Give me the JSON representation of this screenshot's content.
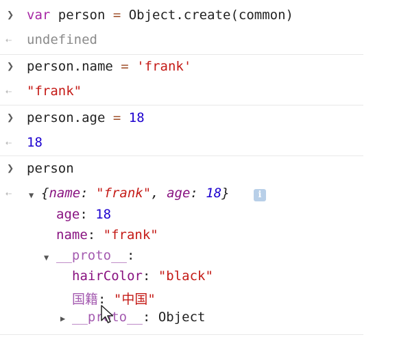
{
  "console": {
    "entries": [
      {
        "input": {
          "tokens": [
            "var",
            " person ",
            "=",
            " Object.create(common)"
          ]
        },
        "output": "undefined"
      },
      {
        "input": {
          "tokens": [
            "person.name ",
            "=",
            " ",
            "'frank'"
          ]
        },
        "output": "\"frank\""
      },
      {
        "input": {
          "tokens": [
            "person.age ",
            "=",
            " ",
            "18"
          ]
        },
        "output": "18"
      },
      {
        "input": {
          "tokens": [
            "person"
          ]
        },
        "object": {
          "summary_open": "{",
          "summary_name_key": "name",
          "summary_colon": ": ",
          "summary_name_val": "\"frank\"",
          "summary_comma": ", ",
          "summary_age_key": "age",
          "summary_age_val": "18",
          "summary_close": "}",
          "info_badge": "i",
          "props": [
            {
              "key": "age",
              "sep": ": ",
              "value": "18"
            },
            {
              "key": "name",
              "sep": ": ",
              "value": "\"frank\""
            }
          ],
          "proto_label": "__proto__",
          "proto_sep": ":",
          "proto_props": [
            {
              "key": "hairColor",
              "sep": ": ",
              "value": "\"black\""
            },
            {
              "key": "国籍",
              "sep": ": ",
              "value": "\"中国\""
            }
          ],
          "inner_proto_label": "__proto__",
          "inner_proto_sep": ": ",
          "inner_proto_value": "Object"
        }
      }
    ]
  },
  "icons": {
    "prompt": "chevron-right-icon",
    "result": "return-arrow-icon",
    "expand_open": "triangle-down-icon",
    "expand_closed": "triangle-right-icon",
    "info": "info-icon",
    "cursor": "mouse-pointer-icon"
  },
  "colors": {
    "keyword": "#a626a4",
    "operator": "#a0522d",
    "string": "#c41a16",
    "number": "#1c00cf",
    "property": "#881280",
    "proto": "#a45bb0"
  }
}
